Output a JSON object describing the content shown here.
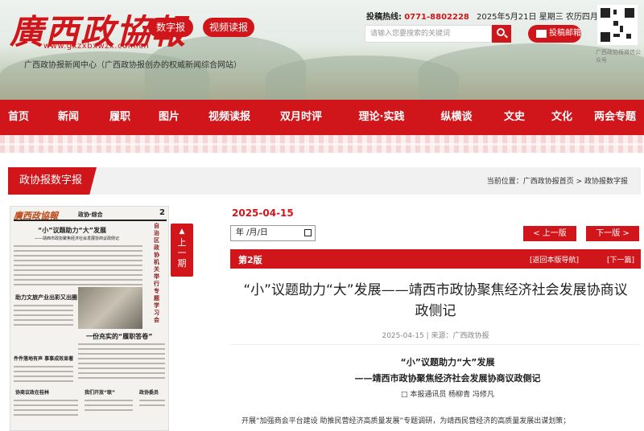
{
  "header": {
    "logo_title": "廣西政協報",
    "logo_url": "www.gxzxbxwzx.com.cn",
    "subtitle": "广西政协报新闻中心（广西政协报创办的权威新闻综合网站）",
    "digital_btn": "数字报",
    "video_btn": "视频读报",
    "hotline_label": "投稿热线:",
    "hotline_number": "0771-8802228",
    "date_text": "2025年5月21日 星期三 农历四月廿四",
    "search_placeholder": "请输入您要搜索的关键词",
    "submit_btn": "投稿邮箱",
    "qr_caption": "广西政协报微信公众号"
  },
  "nav": {
    "items": [
      "首页",
      "新闻",
      "履职",
      "图片",
      "视频读报",
      "双月时评",
      "理论·实践",
      "纵横谈",
      "文史",
      "文化",
      "两会专题"
    ]
  },
  "section": {
    "tab": "政协报数字报",
    "breadcrumb": "当前位置：广西政协报首页 > 政协报数字报"
  },
  "paper": {
    "masthead": "廣西政協報",
    "section_name": "政协·综合",
    "page_number": "2",
    "head1": "“小”议题助力“大”发展",
    "head1_sub": "——靖西市政协聚焦经济社会发展协商议政侧记",
    "head2": "助力文旅产业出彩又出圈",
    "head3": "一份充实的“履职答卷”",
    "head4": "件件落地有声  事事成效显著",
    "head5": "协商议政在桂林",
    "head6": "我们开放“联”",
    "head7": "政协委员",
    "vertical_head": "自治区政协机关举行专题学习会",
    "prev_btn": "上一期",
    "prev_arrow": "▲"
  },
  "toolbar": {
    "issue_date": "2025-04-15",
    "date_input_value": "年 /月/日",
    "prev_edition": "< 上一版",
    "next_edition": "下一版 >"
  },
  "page_bar": {
    "page_label": "第2版",
    "back_nav": "[返回本版导航]",
    "next_page": "[下一篇]"
  },
  "article": {
    "title": "“小”议题助力“大”发展——靖西市政协聚焦经济社会发展协商议政侧记",
    "meta": "2025-04-15 | 来源：广西政协报",
    "subtitle_1": "“小”议题助力“大”发展",
    "subtitle_2": "——靖西市政协聚焦经济社会发展协商议政侧记",
    "byline": "□ 本报通讯员 杨柳青 冯修凡",
    "body_first_line": "开展“加强商会平台建设 助推民营经济高质量发展”专题调研，为靖西民营经济的高质量发展出谋划策；"
  },
  "colors": {
    "brand_red": "#d0161b",
    "section_bg": "#f1f1f1"
  }
}
